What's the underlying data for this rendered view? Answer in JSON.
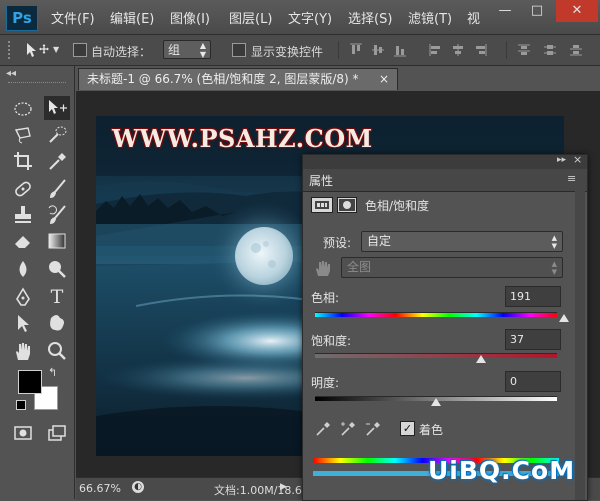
{
  "app": {
    "logo": "Ps"
  },
  "menu": [
    "文件(F)",
    "编辑(E)",
    "图像(I)",
    "图层(L)",
    "文字(Y)",
    "选择(S)",
    "滤镜(T)",
    "视"
  ],
  "window_controls": {
    "minimize": "—",
    "maximize": "□",
    "close": "✕"
  },
  "options_bar": {
    "auto_select_label": "自动选择：",
    "auto_select_value": "组",
    "show_transform_label": "显示变换控件"
  },
  "document": {
    "tab_title": "未标题-1 @ 66.7% (色相/饱和度 2, 图层蒙版/8) *",
    "tab_close": "×",
    "watermark": "WWW.PSAHZ.COM"
  },
  "status_bar": {
    "zoom": "66.67%",
    "doc_info": "文档:1.00M/18.6M"
  },
  "properties_panel": {
    "title": "属性",
    "adjustment_name": "色相/饱和度",
    "preset_label": "预设:",
    "preset_value": "自定",
    "channel_value": "全图",
    "hue_label": "色相:",
    "hue_value": "191",
    "saturation_label": "饱和度:",
    "saturation_value": "37",
    "lightness_label": "明度:",
    "lightness_value": "0",
    "colorize_label": "着色",
    "colorize_checked": true,
    "hue_range": [
      -180,
      180
    ],
    "saturation_range": [
      -100,
      100
    ],
    "lightness_range": [
      -100,
      100
    ]
  },
  "brand_watermark": "UiBQ.CoM",
  "colors": {
    "foreground": "#000000",
    "background": "#ffffff",
    "ps_blue": "#2fa3e6",
    "panel_bg": "#535353"
  }
}
